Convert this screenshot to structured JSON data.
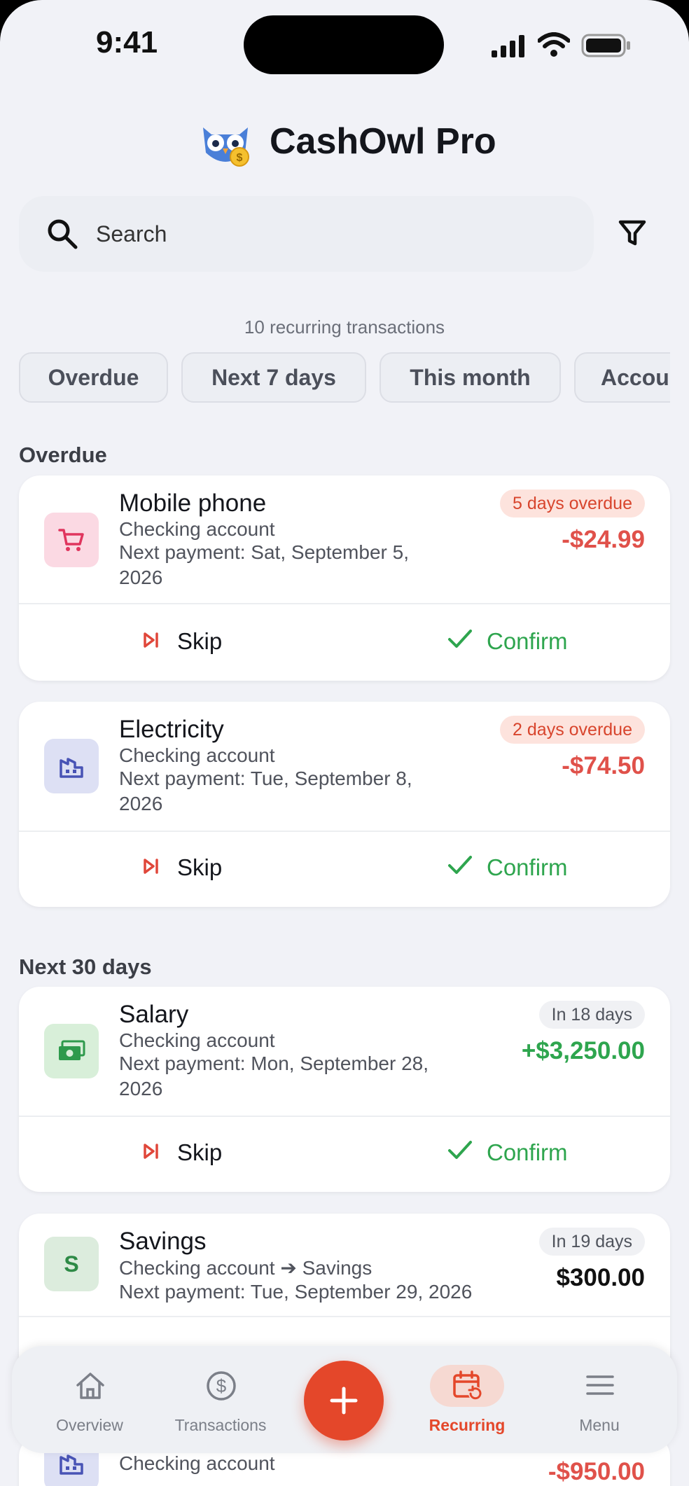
{
  "status_bar": {
    "time": "9:41"
  },
  "header": {
    "app_title": "CashOwl Pro"
  },
  "search": {
    "placeholder": "Search"
  },
  "summary": {
    "count_text": "10 recurring transactions"
  },
  "filters": [
    "Overdue",
    "Next 7 days",
    "This month",
    "Accou"
  ],
  "sections": {
    "overdue": "Overdue",
    "next30": "Next 30 days"
  },
  "transactions": [
    {
      "name": "Mobile phone",
      "account": "Checking account",
      "next": "Next payment: Sat, September 5, 2026",
      "badge": "5 days overdue",
      "amount": "-$24.99",
      "icon": "cart-icon"
    },
    {
      "name": "Electricity",
      "account": "Checking account",
      "next": "Next payment: Tue, September 8, 2026",
      "badge": "2 days overdue",
      "amount": "-$74.50",
      "icon": "building-icon"
    },
    {
      "name": "Salary",
      "account": "Checking account",
      "next": "Next payment: Mon, September 28, 2026",
      "badge": "In 18 days",
      "amount": "+$3,250.00",
      "icon": "cash-icon"
    },
    {
      "name": "Savings",
      "account": "Checking account ➔ Savings",
      "next": "Next payment: Tue, September 29, 2026",
      "badge": "In 19 days",
      "amount": "$300.00",
      "icon": "S"
    },
    {
      "account": "Checking account",
      "amount": "-$950.00",
      "icon": "building-icon"
    }
  ],
  "actions": {
    "skip": "Skip",
    "confirm": "Confirm"
  },
  "tabbar": {
    "overview": "Overview",
    "transactions": "Transactions",
    "recurring": "Recurring",
    "menu": "Menu"
  },
  "colors": {
    "accent": "#e4472a",
    "overdue_red": "#e0514a",
    "income_green": "#2ea54e",
    "background": "#f1f2f7"
  }
}
